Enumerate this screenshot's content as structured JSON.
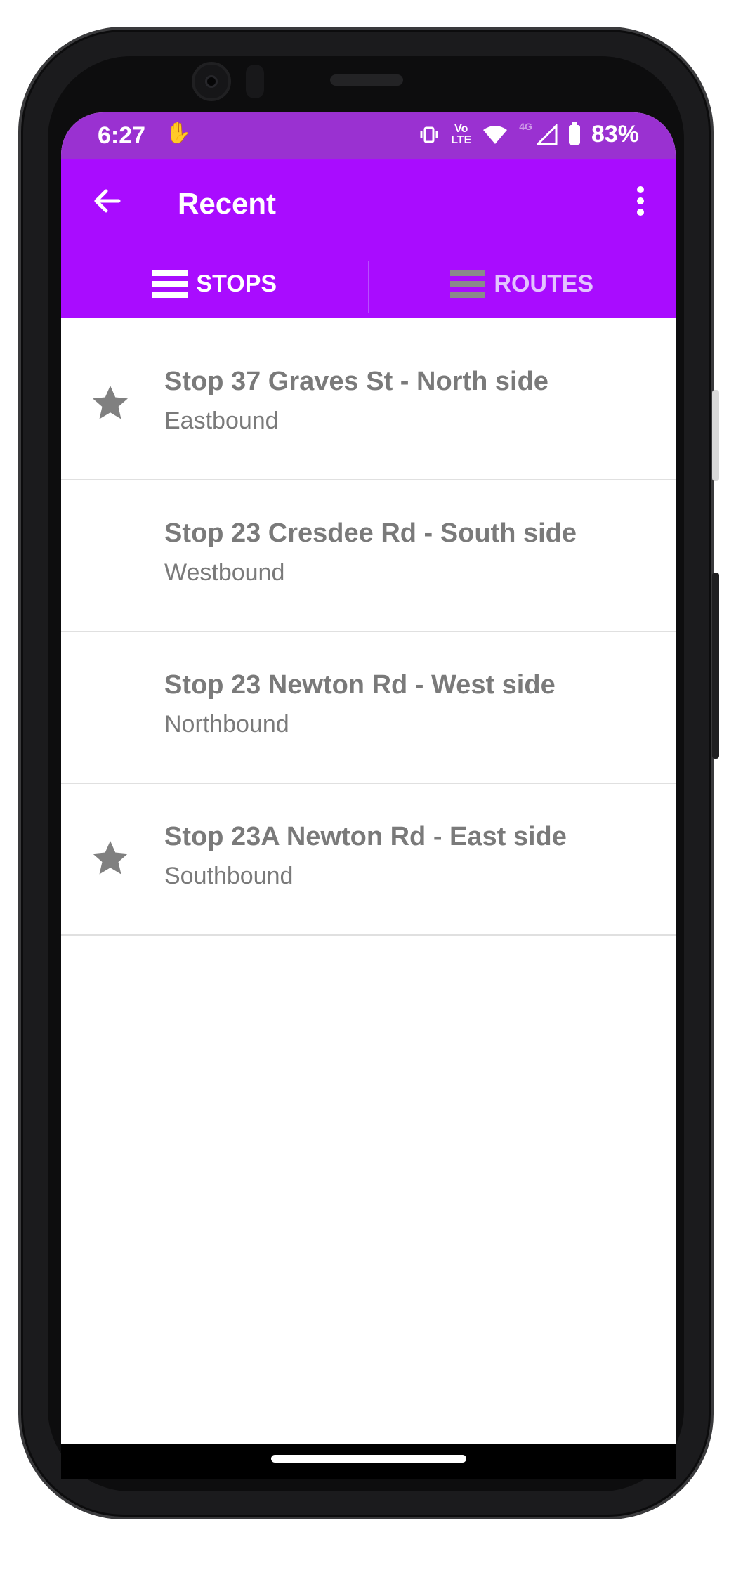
{
  "status_bar": {
    "time": "6:27",
    "notification_icon": "hand-icon",
    "volte_top": "Vo",
    "volte_bottom": "LTE",
    "network": "4G",
    "battery": "83%"
  },
  "app_bar": {
    "title": "Recent",
    "back_icon": "arrow-left-icon",
    "menu_icon": "more-vertical-icon"
  },
  "tabs": [
    {
      "label": "STOPS",
      "active": true
    },
    {
      "label": "ROUTES",
      "active": false
    }
  ],
  "stops": [
    {
      "name": "Stop 37 Graves St - North side",
      "direction": "Eastbound",
      "starred": true
    },
    {
      "name": "Stop 23 Cresdee Rd - South side",
      "direction": "Westbound",
      "starred": false
    },
    {
      "name": "Stop 23 Newton Rd - West side",
      "direction": "Northbound",
      "starred": false
    },
    {
      "name": "Stop 23A Newton Rd - East side",
      "direction": "Southbound",
      "starred": true
    }
  ],
  "colors": {
    "app_bar": "#a90cff",
    "status_bar": "#9a31d1",
    "text_grey": "#7a7a7a"
  }
}
